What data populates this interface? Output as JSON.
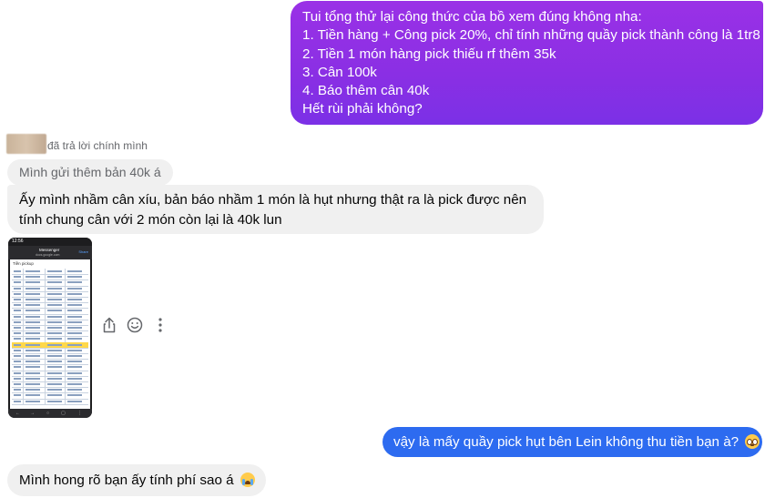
{
  "messages": {
    "outgoing_1": {
      "lines": [
        "Tui tổng thử lại công thức của bồ xem đúng không nha:",
        "1. Tiền hàng + Công pick 20%, chỉ tính những quầy pick thành công là 1tr8",
        "2. Tiền 1 món hàng pick thiếu rf thêm 35k",
        "3. Cân 100k",
        "4. Báo thêm cân 40k",
        "Hết rùi phải không?"
      ],
      "color": "#8a2fe4"
    },
    "reply": {
      "label": "đã trả lời chính mình",
      "quoted_text": "Mình gửi thêm bản 40k á"
    },
    "incoming_1": {
      "lines": [
        "Ấy mình nhầm cân xíu, bản báo nhầm 1 món là hụt nhưng thật ra là pick được nên",
        "tính chung cân với 2 món còn lại là 40k lun"
      ]
    },
    "attachment": {
      "phone_time": "12:56",
      "app_title": "Messenger",
      "app_subtitle": "docs.google.com",
      "app_action": "Share",
      "sheet_tab": "Tiền pickup",
      "icon_names": [
        "share-icon",
        "emoji-reaction-icon",
        "more-options-icon"
      ]
    },
    "outgoing_2": {
      "text": "vậy là mấy quầy pick hụt bên Lein không thu tiền bạn à?",
      "emoji": "flushed-face",
      "color": "#2d6bf0"
    },
    "incoming_2": {
      "text": "Mình hong rõ bạn ấy tính phí sao á",
      "emoji": "loudly-crying-face"
    }
  }
}
